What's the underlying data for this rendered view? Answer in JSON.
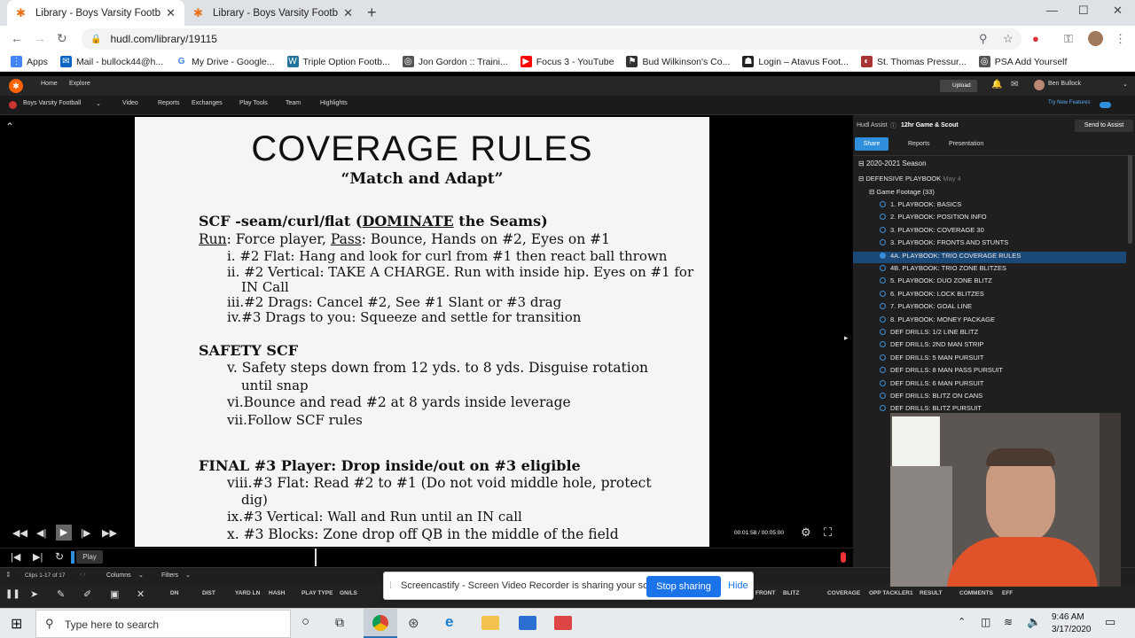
{
  "browser": {
    "tabs": [
      {
        "title": "Library - Boys Varsity Football - H",
        "active": true
      },
      {
        "title": "Library - Boys Varsity Football - H",
        "active": false
      }
    ],
    "url": "hudl.com/library/19115",
    "bookmarks": [
      {
        "label": "Apps",
        "icon": "apps-grid-icon"
      },
      {
        "label": "Mail - bullock44@h...",
        "icon": "mail-icon"
      },
      {
        "label": "My Drive - Google...",
        "icon": "google-icon"
      },
      {
        "label": "Triple Option Footb...",
        "icon": "wordpress-icon"
      },
      {
        "label": "Jon Gordon :: Traini...",
        "icon": "globe-icon"
      },
      {
        "label": "Focus 3 - YouTube",
        "icon": "youtube-icon"
      },
      {
        "label": "Bud Wilkinson's Co...",
        "icon": "football-icon"
      },
      {
        "label": "Login – Atavus Foot...",
        "icon": "atavus-icon"
      },
      {
        "label": "St. Thomas Pressur...",
        "icon": "helmet-icon"
      },
      {
        "label": "PSA Add Yourself",
        "icon": "globe-icon"
      }
    ]
  },
  "hudl": {
    "nav": {
      "home": "Home",
      "explore": "Explore",
      "upload": "Upload",
      "user": "Ben Bullock"
    },
    "team": "Boys Varsity Football",
    "subnav": [
      "Video",
      "Reports",
      "Exchanges",
      "Play Tools",
      "Team",
      "Highlights"
    ],
    "try_features": "Try New Features",
    "assist": {
      "label": "Hudl Assist",
      "plan": "12hr Game & Scout",
      "send": "Send to Assist"
    },
    "panel_tabs": [
      "Share",
      "Reports",
      "Presentation"
    ],
    "tree": {
      "season": "2020-2021 Season",
      "playbook": "DEFENSIVE PLAYBOOK",
      "playbook_date": "May 4",
      "group": "Game Footage (33)",
      "items": [
        "1. PLAYBOOK: BASICS",
        "2. PLAYBOOK: POSITION INFO",
        "3. PLAYBOOK: COVERAGE 30",
        "3. PLAYBOOK: FRONTS AND STUNTS",
        "4A. PLAYBOOK: TRIO COVERAGE RULES",
        "4B. PLAYBOOK: TRIO ZONE BLITZES",
        "5. PLAYBOOK: DUO ZONE BLITZ",
        "6. PLAYBOOK: LOCK BLITZES",
        "7. PLAYBOOK: GOAL LINE",
        "8. PLAYBOOK: MONEY PACKAGE",
        "DEF DRILLS: 1/2 LINE BLITZ",
        "DEF DRILLS: 2ND MAN STRIP",
        "DEF DRILLS: 5 MAN PURSUIT",
        "DEF DRILLS: 8 MAN PASS PURSUIT",
        "DEF DRILLS: 6 MAN PURSUIT",
        "DEF DRILLS: BLITZ ON CANS",
        "DEF DRILLS: BLITZ PURSUIT"
      ],
      "selected_index": 4
    },
    "player": {
      "time": "00:01:58 / 00:05:00",
      "tooltip": "Play"
    },
    "grid": {
      "clips": "Clips 1-17 of 17",
      "columns": "Columns",
      "filters": "Filters"
    },
    "columns": [
      "DN",
      "DIST",
      "YARD LN",
      "HASH",
      "PLAY TYPE",
      "GN/LS",
      "FRONT",
      "BLITZ",
      "COVERAGE",
      "OPP TACKLER1",
      "RESULT",
      "COMMENTS",
      "EFF"
    ]
  },
  "slide": {
    "title": "COVERAGE RULES",
    "subtitle": "“Match and Adapt”",
    "scf_head_a": "SCF -seam/curl/flat (",
    "scf_head_u": "DOMINATE",
    "scf_head_b": " the Seams)",
    "run_a": "Run",
    "run_b": ": Force player, ",
    "run_c": "Pass",
    "run_d": ": Bounce, Hands on #2, Eyes on #1",
    "lines1": [
      "i.  #2 Flat: Hang and look for curl from #1 then react ball thrown",
      "ii. #2 Vertical: TAKE A CHARGE. Run with inside hip. Eyes on #1 for",
      "IN Call",
      "iii.#2 Drags: Cancel #2, See #1 Slant or #3 drag",
      "iv.#3 Drags to you: Squeeze and settle for transition"
    ],
    "safety_head": "SAFETY SCF",
    "lines2": [
      "v. Safety steps down from 12 yds. to 8 yds. Disguise rotation",
      "until snap",
      "vi.Bounce and read #2 at 8 yards inside leverage",
      "vii.Follow SCF rules"
    ],
    "final_head": "FINAL #3 Player: Drop inside/out on #3 eligible",
    "lines3": [
      "viii.#3 Flat: Read #2 to #1 (Do not void middle hole, protect",
      "dig)",
      "ix.#3 Vertical: Wall and Run until an IN call",
      "x. #3 Blocks: Zone drop off QB in the middle of the field"
    ]
  },
  "share_banner": {
    "text": "Screencastify - Screen Video Recorder is sharing your screen.",
    "stop": "Stop sharing",
    "hide": "Hide"
  },
  "taskbar": {
    "search": "Type here to search",
    "time": "9:46 AM",
    "date": "3/17/2020"
  }
}
